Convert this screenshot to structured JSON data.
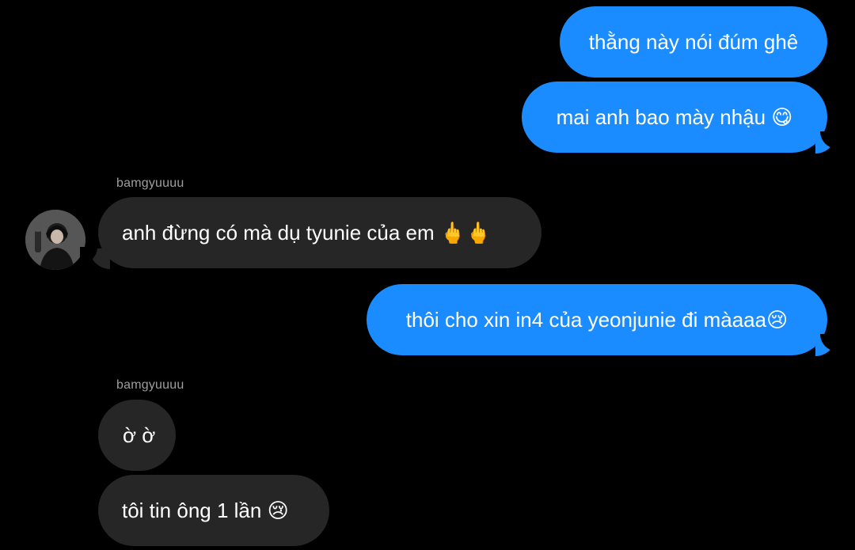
{
  "messages": [
    {
      "from": "me",
      "text": "thằng này nói đúm ghê"
    },
    {
      "from": "me",
      "text": "mai anh bao mày nhậu 😋"
    },
    {
      "from": "other",
      "sender": "bamgyuuuu",
      "text": "anh đừng có mà dụ tyunie của em 🖕🖕"
    },
    {
      "from": "me",
      "text": "thôi cho xin in4 của yeonjunie đi màaaa😢"
    },
    {
      "from": "other",
      "sender": "bamgyuuuu",
      "text": "ờ ờ"
    },
    {
      "from": "other",
      "text": "tôi tin ông 1 lần 😢"
    }
  ],
  "senders": {
    "first": "bamgyuuuu",
    "second": "bamgyuuuu"
  },
  "colors": {
    "background": "#000000",
    "outgoing_bubble": "#1a8cff",
    "incoming_bubble": "#262626",
    "sender_label": "#9e9e9e"
  },
  "icons": {
    "avatar": "user-avatar-photo"
  }
}
